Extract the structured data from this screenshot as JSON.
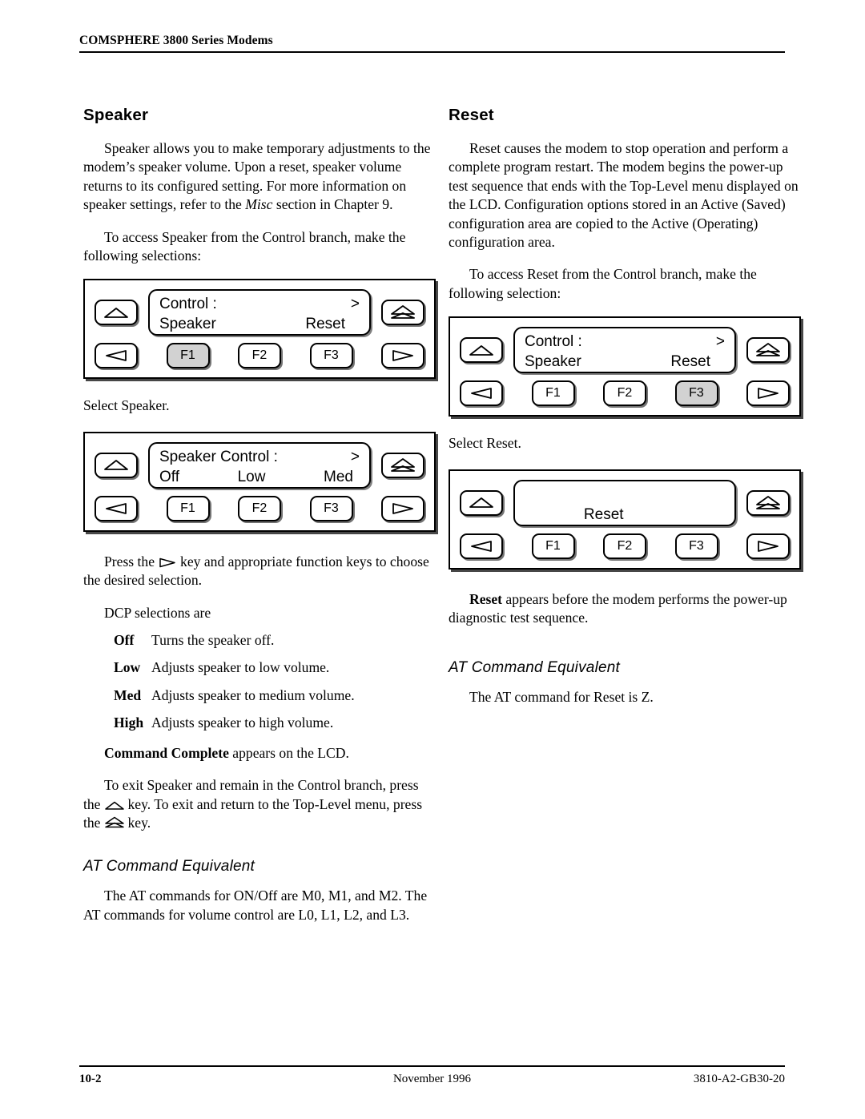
{
  "header": {
    "title": "COMSPHERE 3800 Series Modems"
  },
  "footer": {
    "page_number": "10-2",
    "date": "November 1996",
    "doc_number": "3810-A2-GB30-20"
  },
  "left_column": {
    "heading": "Speaker",
    "intro_paragraph": "Speaker allows you to make temporary adjustments to the modem’s speaker volume. Upon a reset, speaker volume returns to its configured setting. For more information on speaker settings, refer to the ",
    "intro_italic": "Misc",
    "intro_paragraph_end": " section in Chapter 9.",
    "access_paragraph": "To access Speaker from the Control branch, make the following selections:",
    "panel1": {
      "lcd_line1_left": "Control :",
      "lcd_line1_right": ">",
      "lcd_line2_left": "Speaker",
      "lcd_line2_right": "Reset",
      "fkeys": [
        "F1",
        "F2",
        "F3"
      ],
      "highlighted_key": "F1"
    },
    "select_caption": "Select Speaker.",
    "panel2": {
      "lcd_line1_left": "Speaker Control :",
      "lcd_line1_right": ">",
      "lcd_line2_left": "Off",
      "lcd_line2_mid": "Low",
      "lcd_line2_right": "Med",
      "fkeys": [
        "F1",
        "F2",
        "F3"
      ],
      "highlighted_key": ""
    },
    "press_key_pre": "Press the",
    "press_key_post": "key and appropriate function keys to choose the desired selection.",
    "dcp_intro": "DCP selections are",
    "dcp_selections": [
      {
        "term": "Off",
        "desc": "Turns the speaker off."
      },
      {
        "term": "Low",
        "desc": "Adjusts speaker to low volume."
      },
      {
        "term": "Med",
        "desc": "Adjusts speaker to medium volume."
      },
      {
        "term": "High",
        "desc": "Adjusts speaker to high volume."
      }
    ],
    "command_complete_bold": "Command Complete",
    "command_complete_rest": " appears on the LCD.",
    "exit_part1": "To exit Speaker and remain in the Control branch, press the",
    "exit_part2": "key. To exit and return to the Top-Level menu, press the",
    "exit_part3": "key.",
    "at_heading": "AT Command Equivalent",
    "at_text": "The AT commands for ON/Off are M0, M1, and M2. The AT commands for volume control are L0, L1, L2, and L3."
  },
  "right_column": {
    "heading": "Reset",
    "intro_paragraph": "Reset causes the modem to stop operation and perform a complete program restart. The modem begins the power-up test sequence that ends with the Top-Level menu displayed on the LCD. Configuration options stored in an Active (Saved) configuration area are copied to the Active (Operating) configuration area.",
    "access_paragraph": "To access Reset from the Control branch, make the following selection:",
    "panel3": {
      "lcd_line1_left": "Control :",
      "lcd_line1_right": ">",
      "lcd_line2_left": "Speaker",
      "lcd_line2_right": "Reset",
      "fkeys": [
        "F1",
        "F2",
        "F3"
      ],
      "highlighted_key": "F3"
    },
    "select_caption": "Select Reset.",
    "panel4": {
      "lcd_line1_left": "Reset",
      "lcd_line2_left": "",
      "fkeys": [
        "F1",
        "F2",
        "F3"
      ],
      "highlighted_key": ""
    },
    "reset_note_bold": "Reset",
    "reset_note_rest": " appears before the modem performs the power-up diagnostic test sequence.",
    "at_heading": "AT Command Equivalent",
    "at_text": "The AT command for Reset is Z."
  },
  "icons": {
    "up_arrow": "up-triangle-key",
    "left_arrow": "left-triangle-key",
    "right_arrow": "right-triangle-key",
    "top_level": "top-level-double-triangle-key"
  }
}
